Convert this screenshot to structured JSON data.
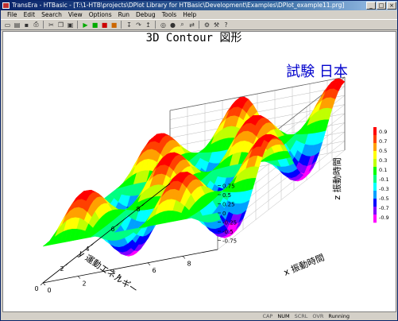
{
  "window": {
    "title": "TransEra - HTBasic - [T:\\1-HTB\\projects\\DPlot Library for HTBasic\\Development\\Examples\\DPlot_example11.prg]"
  },
  "menu": [
    "File",
    "Edit",
    "Search",
    "View",
    "Options",
    "Run",
    "Debug",
    "Tools",
    "Help"
  ],
  "status": {
    "cap": "CAP",
    "num": "NUM",
    "scrl": "SCRL",
    "ovr": "OVR",
    "state": "Running"
  },
  "colors": {
    "accent": "#0000cc",
    "title_bar": "#0a246a"
  },
  "chart_data": {
    "type": "surface",
    "title": "3D Contour 図形",
    "annotation": "試験 日本",
    "xlabel": "x 振動時間",
    "ylabel": "y 運動エネルギー",
    "zlabel": "z 振動時間",
    "xlim": [
      0,
      10
    ],
    "ylim": [
      0,
      10
    ],
    "zlim": [
      -1,
      1
    ],
    "x_ticks": [
      "0",
      "2",
      "4",
      "6",
      "8"
    ],
    "y_ticks": [
      "0",
      "2",
      "4",
      "6",
      "8"
    ],
    "z_ticks": [
      "0.75",
      "0.5",
      "0.25",
      "0",
      "-0.25",
      "-0.5",
      "-0.75"
    ],
    "colorbar_ticks": [
      "0.9",
      "0.7",
      "0.5",
      "0.3",
      "0.1",
      "-0.1",
      "-0.3",
      "-0.5",
      "-0.7",
      "-0.9"
    ],
    "colormap": [
      "#ff00ff",
      "#8000ff",
      "#0000ff",
      "#00a0ff",
      "#00ffff",
      "#00ff80",
      "#00ff00",
      "#c0ff00",
      "#ffff00",
      "#ffa000",
      "#ff4000",
      "#ff0000"
    ],
    "function": "z = sin(x)·sin(y)",
    "grid": true
  }
}
